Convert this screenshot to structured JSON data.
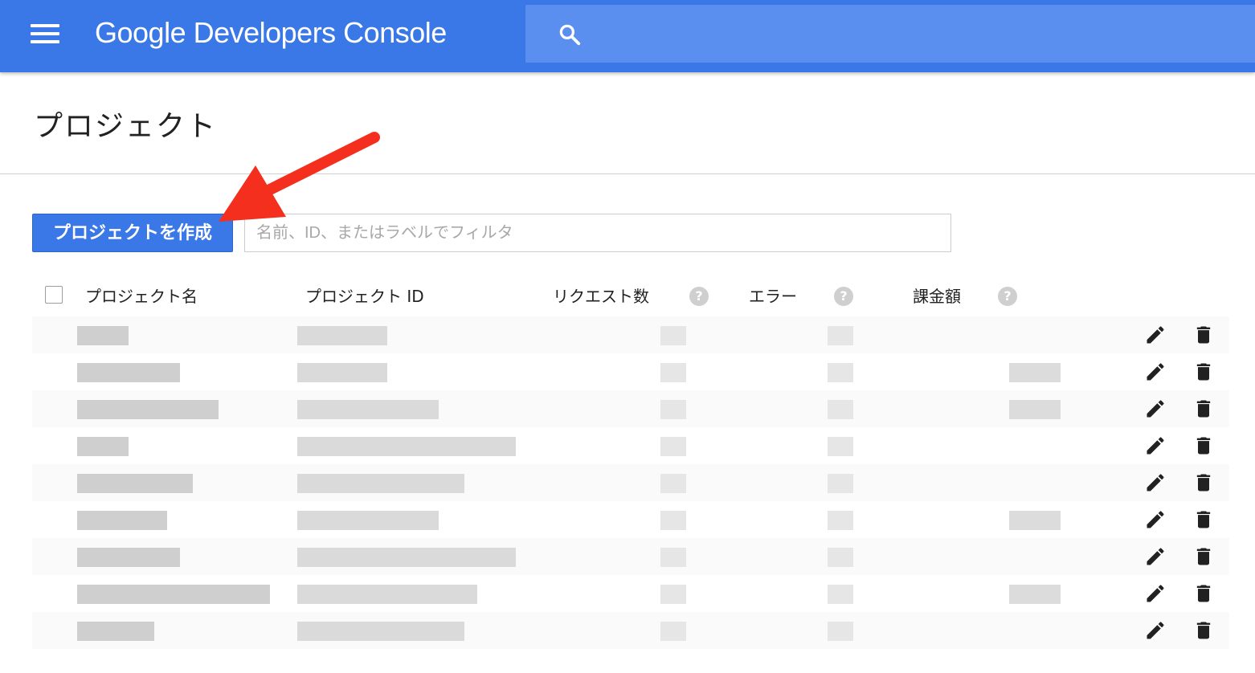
{
  "header": {
    "brand": "Google Developers Console",
    "menu_icon": "hamburger-menu-icon",
    "search_icon": "search-icon",
    "search_placeholder": ""
  },
  "page": {
    "title": "プロジェクト",
    "create_button": "プロジェクトを作成",
    "filter_placeholder": "名前、ID、またはラベルでフィルタ"
  },
  "table": {
    "columns": {
      "name": "プロジェクト名",
      "id": "プロジェクト ID",
      "requests": "リクエスト数",
      "errors": "エラー",
      "billing": "課金額"
    },
    "help_glyph": "?",
    "row_count": 9,
    "row_actions": [
      "pencil-icon",
      "trash-icon"
    ],
    "cell_note": "cell contents are pixelated / obscured in the screenshot"
  },
  "colors": {
    "appbar": "#3b78e7",
    "search_bar": "#5a8ff0",
    "primary_button": "#3b78e7",
    "annotation_arrow": "#f52f1e"
  }
}
